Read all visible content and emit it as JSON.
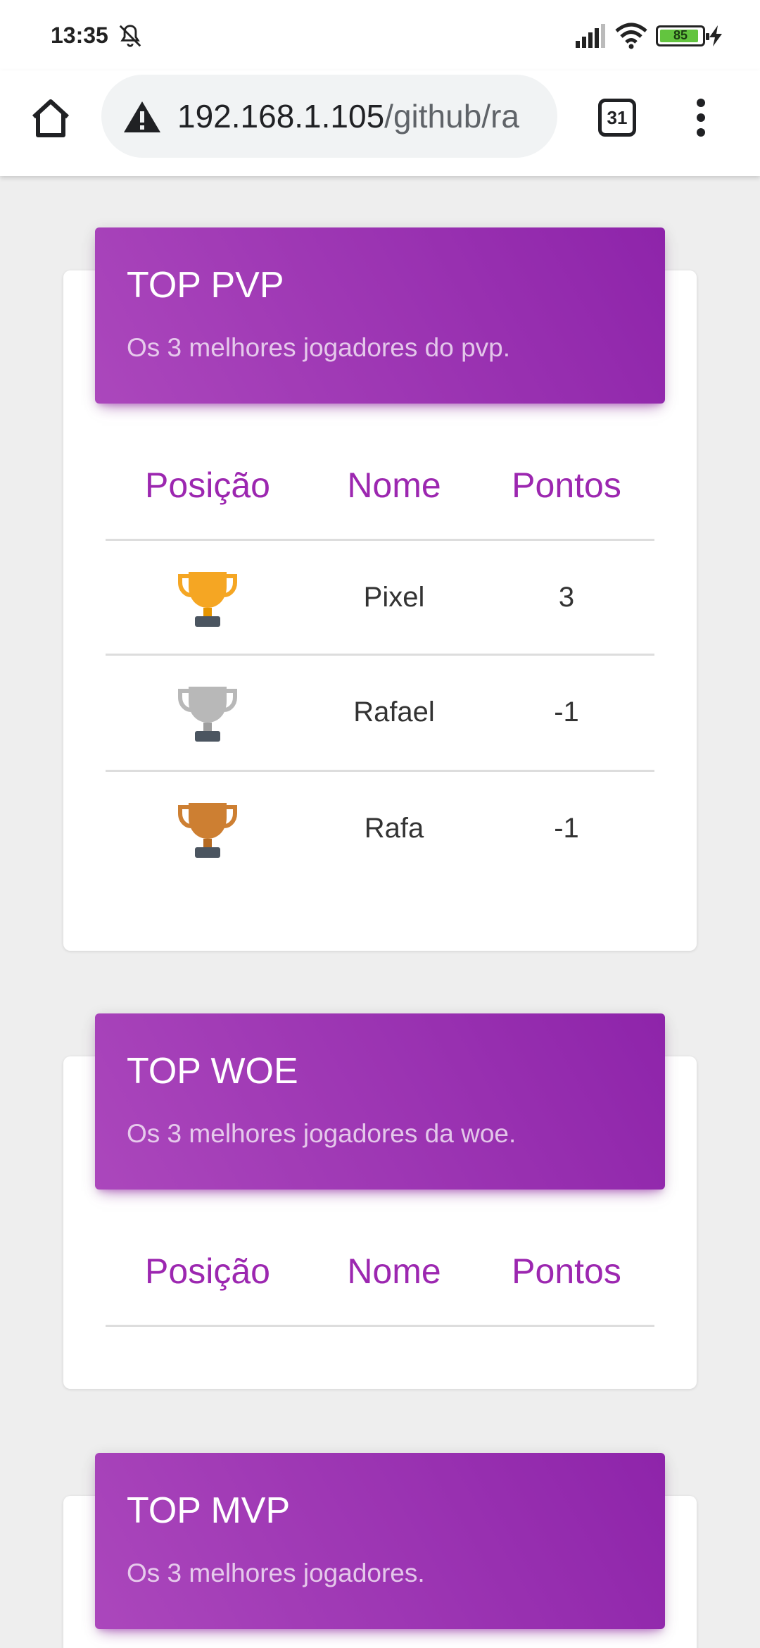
{
  "status_bar": {
    "time": "13:35",
    "battery_level": "85"
  },
  "browser": {
    "url_host": "192.168.1.105",
    "url_path": "/github/ra",
    "tab_count": "31"
  },
  "colors": {
    "accent": "#9c27b0",
    "gold": "#f5a623",
    "silver": "#b8b8b8",
    "bronze": "#cd7f32"
  },
  "columns": {
    "position": "Posição",
    "name": "Nome",
    "points": "Pontos"
  },
  "sections": [
    {
      "title": "TOP PVP",
      "subtitle": "Os 3 melhores jogadores do pvp.",
      "rows": [
        {
          "trophy": "gold-trophy-icon",
          "name": "Pixel",
          "points": "3"
        },
        {
          "trophy": "silver-trophy-icon",
          "name": "Rafael",
          "points": "-1"
        },
        {
          "trophy": "bronze-trophy-icon",
          "name": "Rafa",
          "points": "-1"
        }
      ]
    },
    {
      "title": "TOP WOE",
      "subtitle": "Os 3 melhores jogadores da woe.",
      "rows": []
    },
    {
      "title": "TOP MVP",
      "subtitle": "Os 3 melhores jogadores."
    }
  ]
}
